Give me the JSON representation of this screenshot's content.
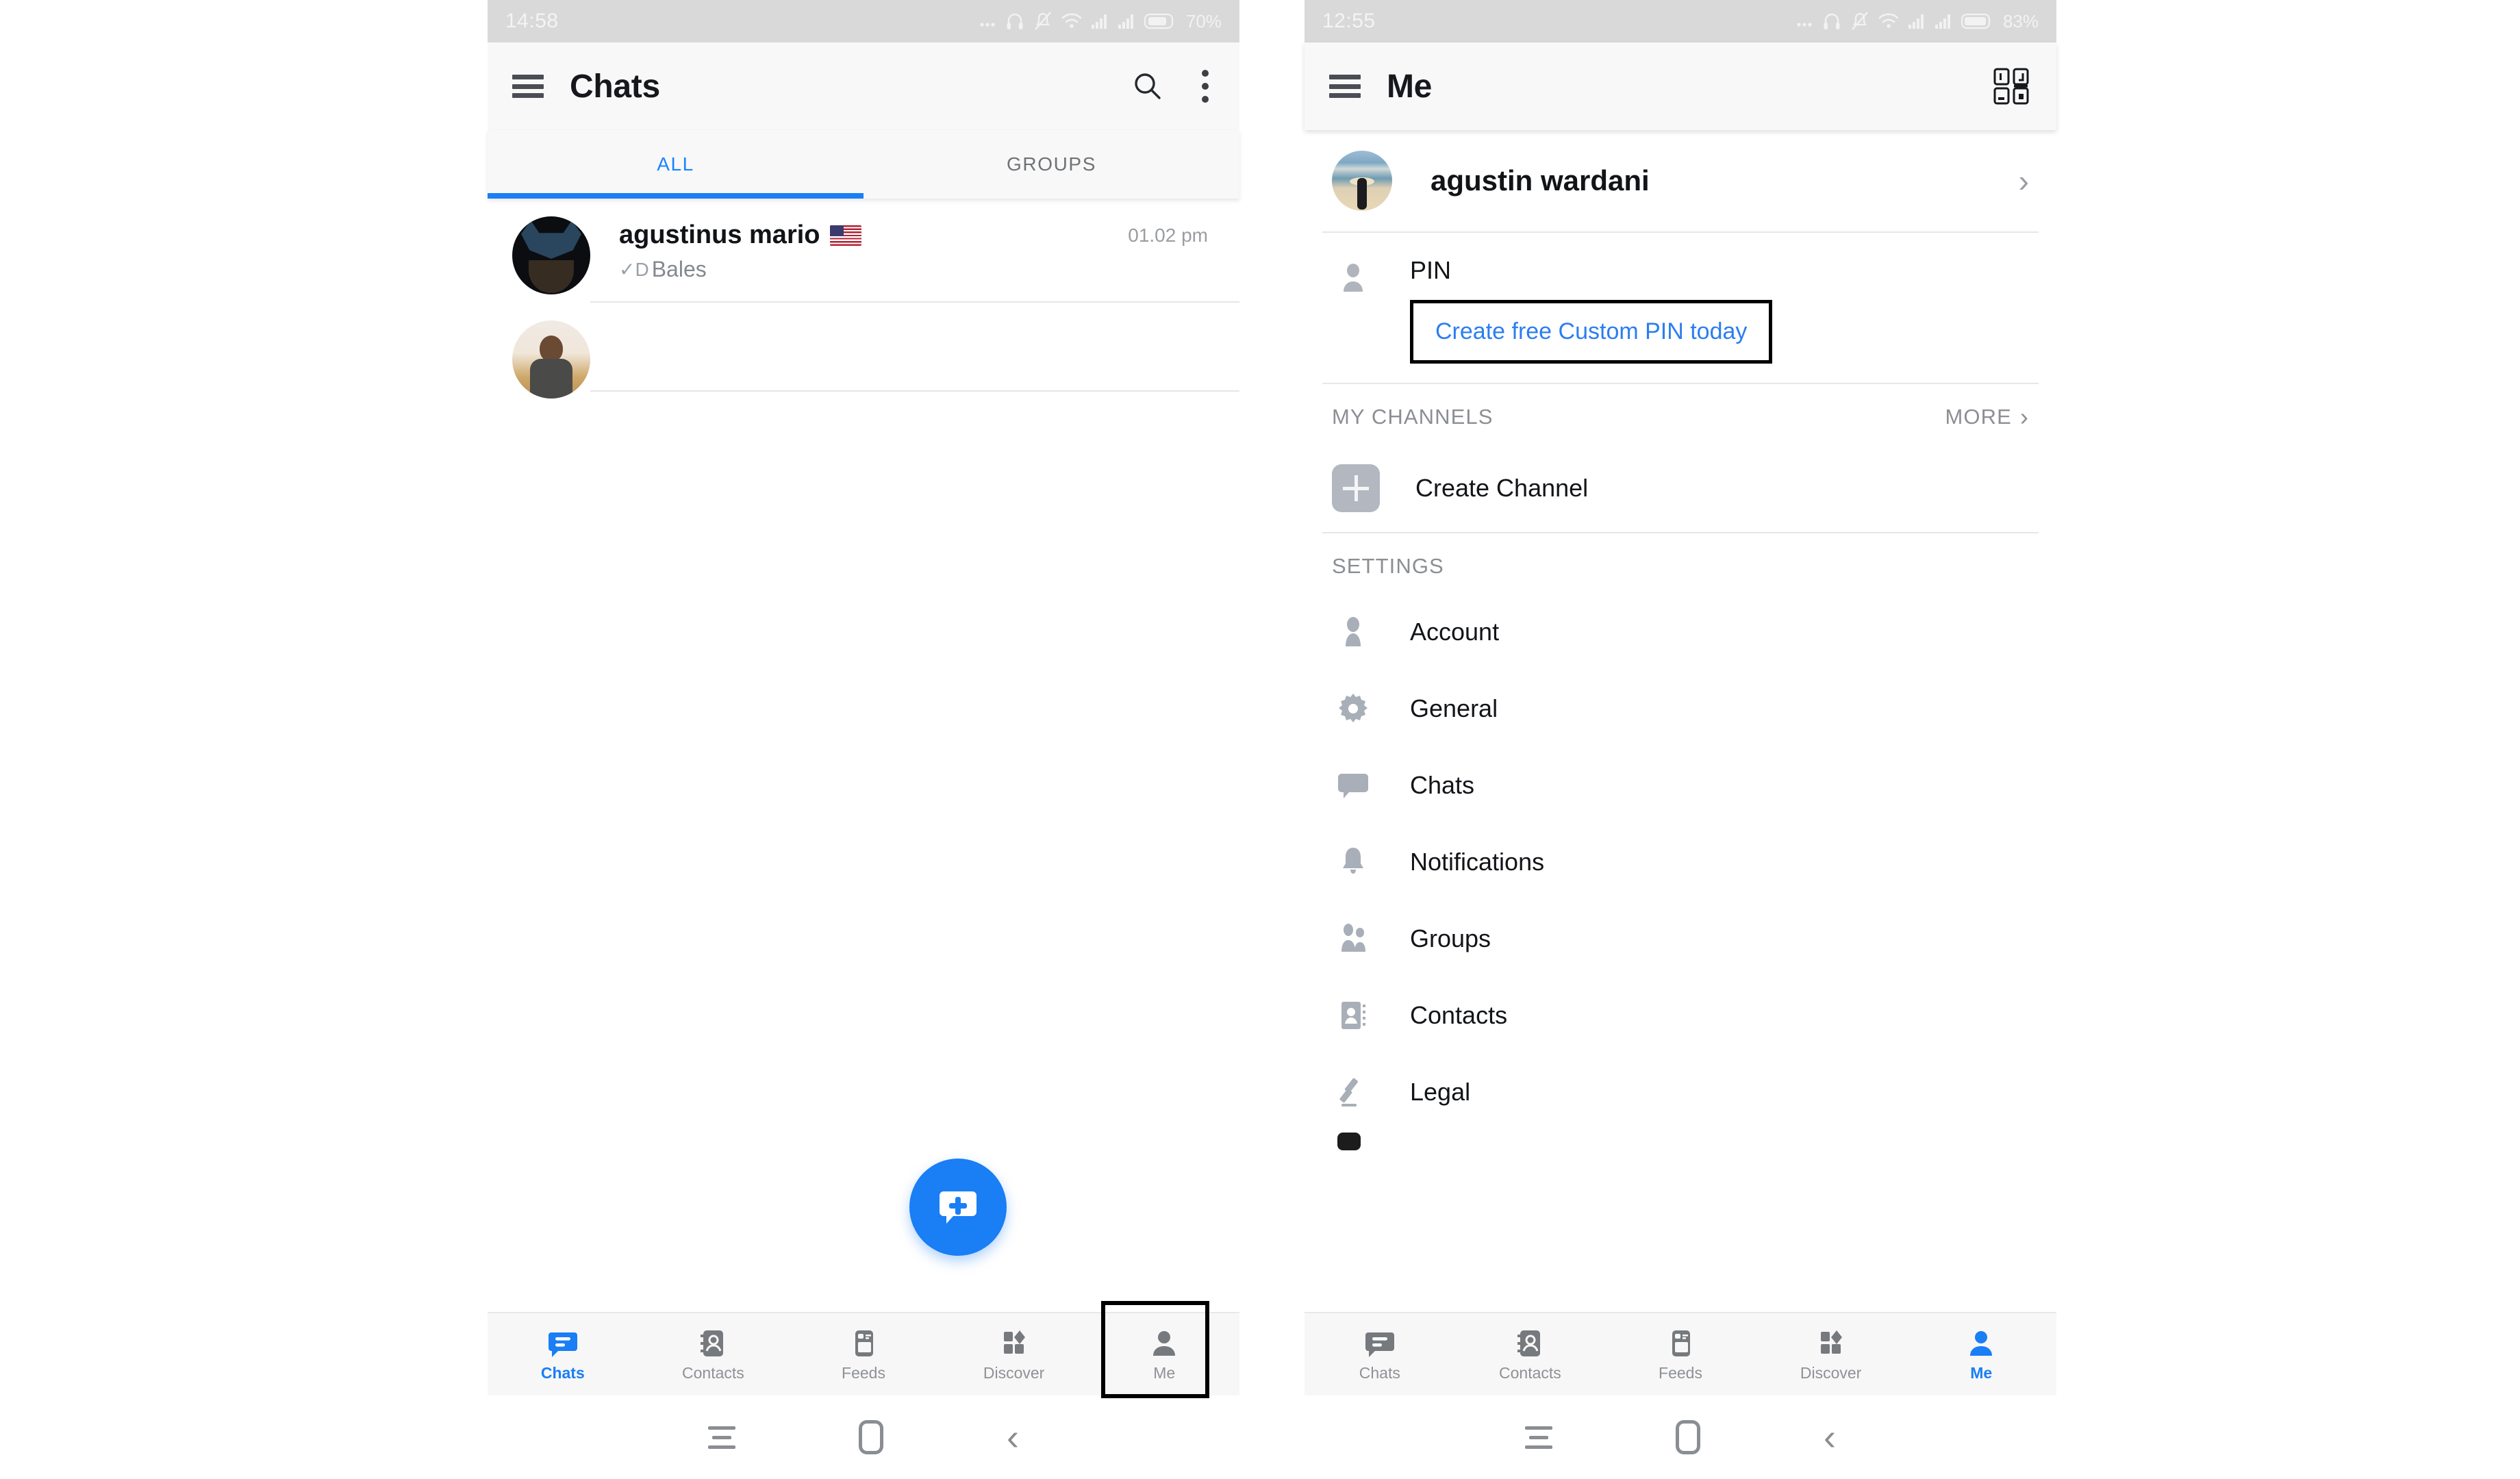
{
  "phones": {
    "left": {
      "status": {
        "time": "14:58",
        "battery": "70%",
        "icons": [
          "more-dots-icon",
          "headphone-icon",
          "mute-bell-icon",
          "wifi-icon",
          "signal-icon",
          "signal2-icon",
          "battery-icon"
        ]
      },
      "appbar": {
        "menu_icon": "hamburger-icon",
        "title": "Chats",
        "search_icon": "search-icon",
        "overflow_icon": "kebab-menu-icon"
      },
      "tabs": [
        {
          "label": "ALL",
          "active": true
        },
        {
          "label": "GROUPS",
          "active": false
        }
      ],
      "chats": [
        {
          "name": "agustinus mario",
          "flag": "us-flag-icon",
          "status_tick": "✓D",
          "preview": "Bales",
          "time": "01.02 pm",
          "avatar": "batman-avatar"
        },
        {
          "name": "",
          "flag": "",
          "status_tick": "",
          "preview": "",
          "time": "",
          "avatar": "photo-avatar"
        }
      ],
      "fab": {
        "icon": "new-chat-icon"
      },
      "bottom_nav": [
        {
          "label": "Chats",
          "icon": "chat-bubble-icon",
          "active": true
        },
        {
          "label": "Contacts",
          "icon": "contacts-book-icon",
          "active": false
        },
        {
          "label": "Feeds",
          "icon": "feeds-card-icon",
          "active": false
        },
        {
          "label": "Discover",
          "icon": "discover-shapes-icon",
          "active": false
        },
        {
          "label": "Me",
          "icon": "person-icon",
          "active": false,
          "highlighted": true
        }
      ]
    },
    "right": {
      "status": {
        "time": "12:55",
        "battery": "83%",
        "icons": [
          "more-dots-icon",
          "headphone-icon",
          "mute-bell-icon",
          "wifi-icon",
          "signal-icon",
          "signal2-icon",
          "battery-icon"
        ]
      },
      "appbar": {
        "menu_icon": "hamburger-icon",
        "title": "Me",
        "qr_icon": "qr-code-icon"
      },
      "profile": {
        "name": "agustin wardani",
        "avatar": "beach-avatar",
        "chevron": "chevron-right-icon"
      },
      "pin": {
        "icon": "person-outline-icon",
        "title": "PIN",
        "cta": "Create free Custom PIN today",
        "highlighted": true
      },
      "my_channels": {
        "header": "MY CHANNELS",
        "more": "MORE",
        "more_chevron": "chevron-right-icon",
        "items": [
          {
            "label": "Create Channel",
            "icon": "plus-tile-icon"
          }
        ]
      },
      "settings": {
        "header": "SETTINGS",
        "items": [
          {
            "label": "Account",
            "icon": "person-filled-icon"
          },
          {
            "label": "General",
            "icon": "gear-icon"
          },
          {
            "label": "Chats",
            "icon": "chat-bubble-icon"
          },
          {
            "label": "Notifications",
            "icon": "bell-icon"
          },
          {
            "label": "Groups",
            "icon": "group-people-icon"
          },
          {
            "label": "Contacts",
            "icon": "contacts-book-icon"
          },
          {
            "label": "Legal",
            "icon": "gavel-icon"
          }
        ]
      },
      "bottom_nav": [
        {
          "label": "Chats",
          "icon": "chat-bubble-icon",
          "active": false
        },
        {
          "label": "Contacts",
          "icon": "contacts-book-icon",
          "active": false
        },
        {
          "label": "Feeds",
          "icon": "feeds-card-icon",
          "active": false
        },
        {
          "label": "Discover",
          "icon": "discover-shapes-icon",
          "active": false
        },
        {
          "label": "Me",
          "icon": "person-icon",
          "active": true
        }
      ]
    }
  },
  "colors": {
    "accent": "#1a7ef5",
    "link": "#2b7ef0",
    "statusbar": "#d9d9d9",
    "appbar": "#f8f8f8",
    "muted": "#8b8e93",
    "highlight": "#000000"
  }
}
